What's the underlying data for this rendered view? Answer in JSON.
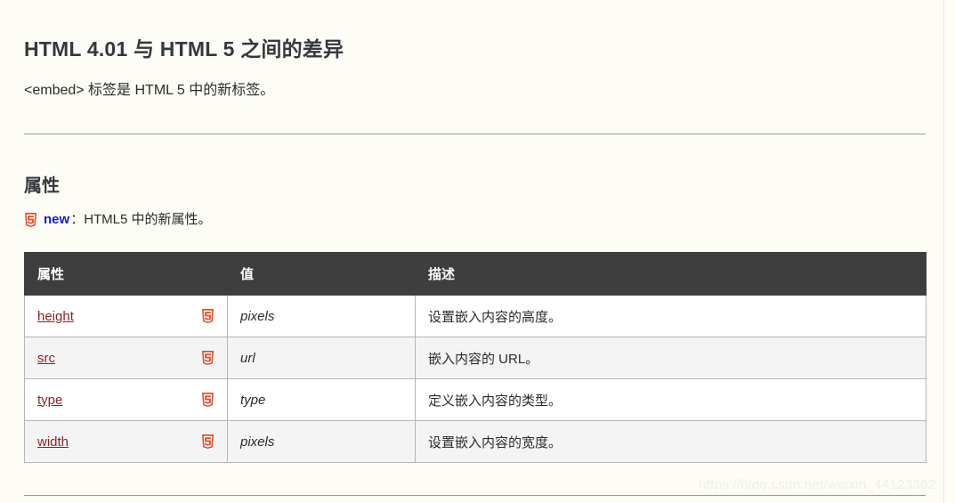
{
  "page": {
    "title": "HTML 4.01 与 HTML 5 之间的差异",
    "intro": "<embed> 标签是 HTML 5 中的新标签。",
    "section_title": "属性",
    "watermark": "https://blog.csdn.net/weixin_44123362"
  },
  "legend": {
    "badge_icon": "html5-badge-icon",
    "new_label": "new",
    "description": "：HTML5 中的新属性。",
    "new_color": "#1318d6",
    "badge_color": "#e44d26"
  },
  "table": {
    "headers": [
      "属性",
      "值",
      "描述"
    ],
    "rows": [
      {
        "attribute": "height",
        "badge": "html5-badge-icon",
        "value": "pixels",
        "description": "设置嵌入内容的高度。"
      },
      {
        "attribute": "src",
        "badge": "html5-badge-icon",
        "value": "url",
        "description": "嵌入内容的 URL。"
      },
      {
        "attribute": "type",
        "badge": "html5-badge-icon",
        "value": "type",
        "description": "定义嵌入内容的类型。"
      },
      {
        "attribute": "width",
        "badge": "html5-badge-icon",
        "value": "pixels",
        "description": "设置嵌入内容的宽度。"
      }
    ]
  },
  "theme": {
    "background": "#fdfdf6",
    "header_bg": "#3e3e3e",
    "link_color": "#8f1f1f",
    "row_alt_bg": "#f4f4f4",
    "border_color": "#b5b5b5"
  }
}
